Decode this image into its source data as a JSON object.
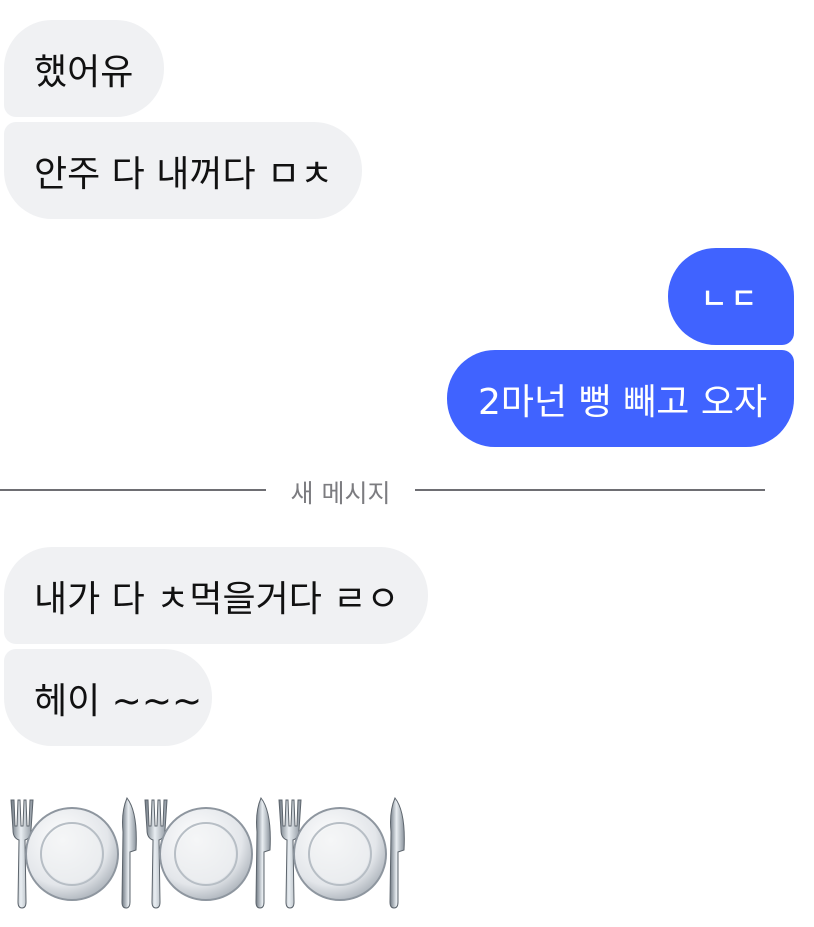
{
  "messages": [
    {
      "id": "in1",
      "direction": "incoming",
      "text": "했어유"
    },
    {
      "id": "in2",
      "direction": "incoming",
      "text": "안주 다 내꺼다 ㅁㅊ"
    },
    {
      "id": "out1",
      "direction": "outgoing",
      "text": "ㄴㄷ"
    },
    {
      "id": "out2",
      "direction": "outgoing",
      "text": "2마넌 뻥 빼고 오자"
    },
    {
      "id": "in3",
      "direction": "incoming",
      "text": "내가 다 ㅊ먹을거다 ㄹㅇ"
    },
    {
      "id": "in4",
      "direction": "incoming",
      "text": "헤이 ~~~"
    },
    {
      "id": "emoji1",
      "direction": "incoming",
      "text": "",
      "emoji": [
        "fork-knife-plate-icon",
        "fork-knife-plate-icon",
        "fork-knife-plate-icon"
      ]
    }
  ],
  "divider": {
    "label": "새 메시지"
  },
  "colors": {
    "outgoing_bubble": "#4063ff",
    "incoming_bubble": "#f0f1f3",
    "divider_line": "#6e6e73",
    "divider_text": "#7c7c80"
  }
}
